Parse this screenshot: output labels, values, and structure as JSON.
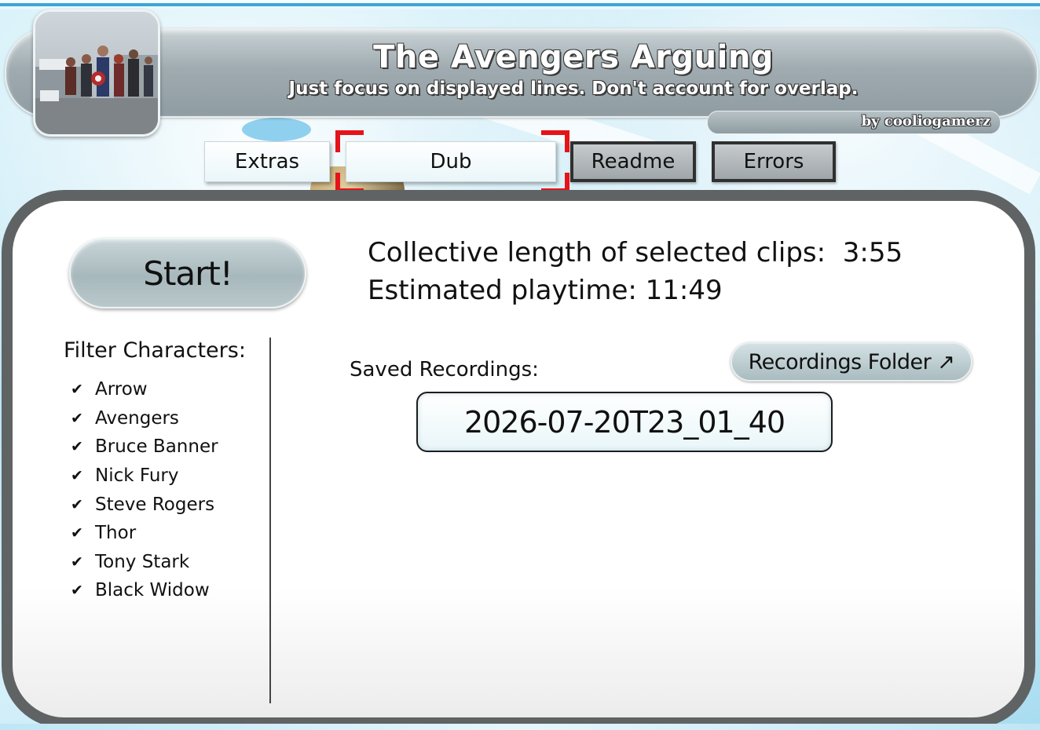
{
  "header": {
    "title": "The Avengers Arguing",
    "subtitle": "Just focus on displayed lines. Don't account for overlap.",
    "author": "by cooliogamerz"
  },
  "tabs": [
    {
      "label": "Extras",
      "style": "light"
    },
    {
      "label": "Dub",
      "style": "light",
      "selected": true
    },
    {
      "label": "Readme",
      "style": "dark"
    },
    {
      "label": "Errors",
      "style": "dark"
    }
  ],
  "main": {
    "start_label": "Start!",
    "collective_length_label": "Collective length of selected clips:",
    "collective_length_value": "3:55",
    "playtime_label": "Estimated playtime:",
    "playtime_value": "11:49"
  },
  "filter": {
    "title": "Filter Characters:",
    "items": [
      {
        "label": "Arrow",
        "checked": true
      },
      {
        "label": "Avengers",
        "checked": true
      },
      {
        "label": "Bruce Banner",
        "checked": true
      },
      {
        "label": "Nick Fury",
        "checked": true
      },
      {
        "label": "Steve Rogers",
        "checked": true
      },
      {
        "label": "Thor",
        "checked": true
      },
      {
        "label": "Tony Stark",
        "checked": true
      },
      {
        "label": "Black Widow",
        "checked": true
      }
    ]
  },
  "recordings": {
    "label": "Saved Recordings:",
    "folder_button": "Recordings Folder ↗",
    "items": [
      "2026-07-20T23_01_40"
    ]
  },
  "colors": {
    "panel_border": "#606364",
    "selection_bracket": "#e4141a",
    "banner": "#9fabb0"
  }
}
